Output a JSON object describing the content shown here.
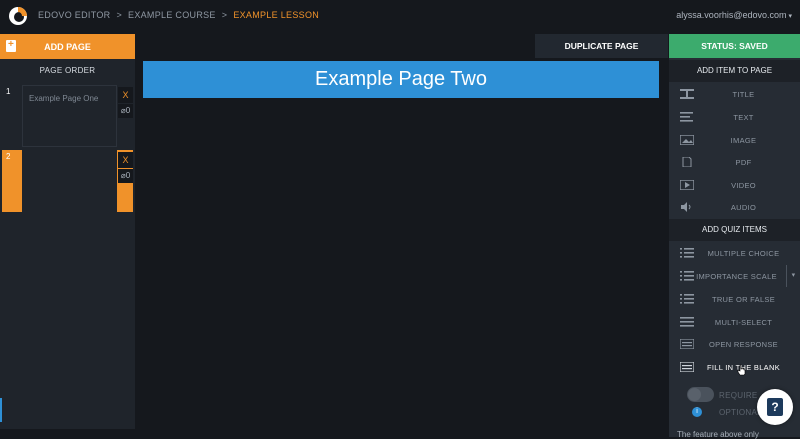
{
  "header": {
    "breadcrumbs": [
      "EDOVO EDITOR",
      "EXAMPLE COURSE",
      "EXAMPLE LESSON"
    ],
    "separator": ">",
    "user_email": "alyssa.voorhis@edovo.com"
  },
  "left_panel": {
    "add_page_label": "ADD PAGE",
    "page_order_label": "PAGE ORDER",
    "pages": [
      {
        "number": "1",
        "title": "Example Page One",
        "delete": "X",
        "count": "0"
      },
      {
        "number": "2",
        "title": "",
        "delete": "X",
        "count": "0"
      }
    ]
  },
  "toolbar": {
    "duplicate_label": "DUPLICATE PAGE"
  },
  "canvas": {
    "page_title": "Example Page Two"
  },
  "right_panel": {
    "status_label": "STATUS: SAVED",
    "add_item_header": "ADD ITEM TO PAGE",
    "items": [
      {
        "label": "TITLE",
        "icon": "title-icon"
      },
      {
        "label": "TEXT",
        "icon": "text-icon"
      },
      {
        "label": "IMAGE",
        "icon": "image-icon"
      },
      {
        "label": "PDF",
        "icon": "pdf-icon"
      },
      {
        "label": "VIDEO",
        "icon": "video-icon"
      },
      {
        "label": "AUDIO",
        "icon": "audio-icon"
      }
    ],
    "quiz_header": "ADD QUIZ ITEMS",
    "quiz_items": [
      {
        "label": "MULTIPLE CHOICE",
        "icon": "list-icon"
      },
      {
        "label": "IMPORTANCE SCALE",
        "icon": "list-icon"
      },
      {
        "label": "TRUE OR FALSE",
        "icon": "list-icon"
      },
      {
        "label": "MULTI-SELECT",
        "icon": "list-icon"
      },
      {
        "label": "OPEN RESPONSE",
        "icon": "response-icon"
      },
      {
        "label": "FILL IN THE BLANK",
        "icon": "response-icon"
      }
    ],
    "required_label": "REQUIRE",
    "optional_label": "OPTIONAL",
    "feature_note": "The feature above only"
  },
  "colors": {
    "accent": "#f0922a",
    "status_green": "#3cab6d",
    "title_blue": "#2e90d6",
    "background": "#15181d"
  }
}
